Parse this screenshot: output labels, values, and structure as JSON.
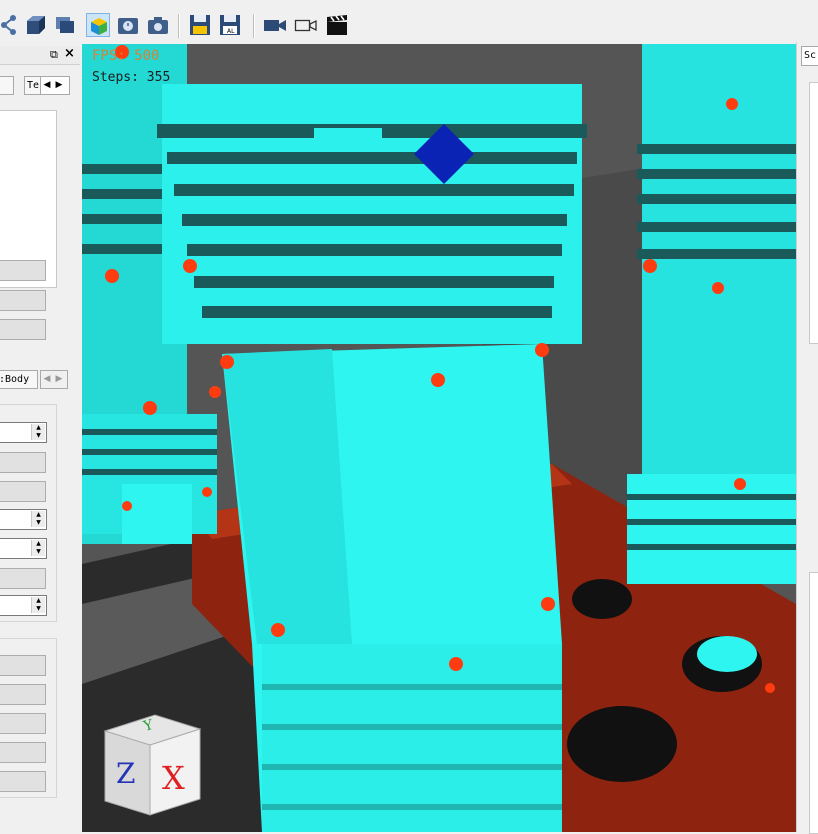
{
  "toolbar": {
    "buttons": [
      {
        "name": "share",
        "icon": "share-icon"
      },
      {
        "name": "solid-box",
        "icon": "cube-solid-icon"
      },
      {
        "name": "layers",
        "icon": "layers-icon"
      },
      {
        "name": "color-cube",
        "icon": "colored-cube-icon"
      },
      {
        "name": "timer",
        "icon": "stopwatch-icon"
      },
      {
        "name": "screenshot",
        "icon": "camera-icon"
      },
      {
        "name": "save",
        "icon": "floppy-save-icon"
      },
      {
        "name": "save-all",
        "icon": "floppy-save-all-icon"
      },
      {
        "name": "record-video",
        "icon": "video-camera-icon"
      },
      {
        "name": "record-outline",
        "icon": "video-camera-outline-icon"
      },
      {
        "name": "clapperboard",
        "icon": "clapperboard-icon"
      }
    ]
  },
  "left_panel": {
    "float_icon": "⧉",
    "close_icon": "×",
    "tab_a": "",
    "tab_b": "Te",
    "tab2_label": ":Body"
  },
  "viewport": {
    "fps_label": "FPS: 500",
    "steps_label": "Steps: 355",
    "colors": {
      "cyan": "#2ef5f0",
      "dark_band": "#1b5a5a",
      "red": "#8e2410",
      "marker": "#ff3b10",
      "selection": "#0a23b4"
    },
    "navcube": {
      "z_label": "Z",
      "x_label": "X",
      "y_label": "Y"
    }
  },
  "right_panel": {
    "tab_label": "Sc"
  }
}
